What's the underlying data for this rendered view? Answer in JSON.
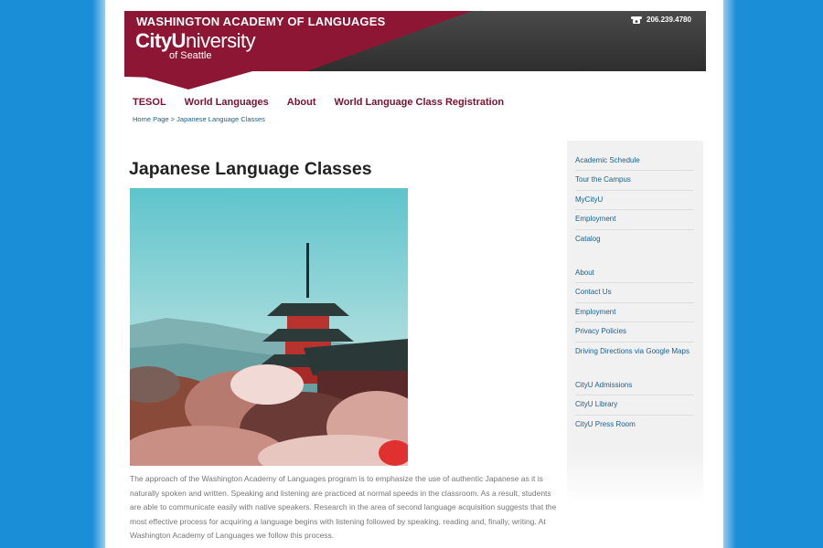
{
  "header": {
    "title": "WASHINGTON ACADEMY OF LANGUAGES",
    "logo_bold": "CityU",
    "logo_regular": "niversity",
    "logo_sub": "of Seattle",
    "phone": "206.239.4780",
    "colors": {
      "brand_red": "#8c1634",
      "header_dark": "#3a3a3a"
    }
  },
  "nav": {
    "items": [
      {
        "label": "TESOL"
      },
      {
        "label": "World Languages"
      },
      {
        "label": "About"
      },
      {
        "label": "World Language Class Registration"
      }
    ]
  },
  "breadcrumb": {
    "home": "Home Page",
    "separator": " > ",
    "current": "Japanese Language Classes"
  },
  "main": {
    "title": "Japanese Language Classes",
    "paragraph": "The approach of the Washington Academy of Languages program is to  emphasize the use of authentic Japanese as it is naturally spoken and written.  Speaking and listening are practiced at normal speeds in the classroom. As a  result, students are able to communicate easily with native speakers. Research  in the area of second language acquisition suggests that the most effective  process for acquiring a language begins with listening followed by speaking,  reading and, finally, writing. At Washington Academy of Languages we follow  this process."
  },
  "sidebar": {
    "group1": [
      {
        "label": "Academic Schedule"
      },
      {
        "label": "Tour the Campus"
      },
      {
        "label": "MyCityU"
      },
      {
        "label": "Employment"
      },
      {
        "label": "Catalog"
      }
    ],
    "group2": [
      {
        "label": "About"
      },
      {
        "label": "Contact Us"
      },
      {
        "label": "Employment"
      },
      {
        "label": "Privacy Policies"
      },
      {
        "label": "Driving Directions via Google Maps"
      }
    ],
    "group3": [
      {
        "label": "CityU Admissions"
      },
      {
        "label": "CityU Library"
      },
      {
        "label": "CityU Press Room"
      }
    ]
  }
}
